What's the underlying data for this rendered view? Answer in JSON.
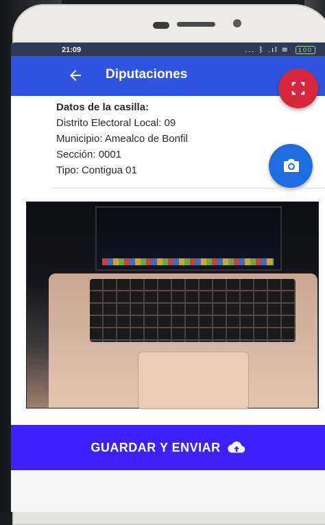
{
  "status_bar": {
    "time": "21:09",
    "indicators": "... ᛒ .ıl ≋",
    "battery": "100"
  },
  "app_bar": {
    "title": "Diputaciones",
    "back_icon": "arrow-left-icon"
  },
  "fab_scan": {
    "icon": "scan-frame-icon",
    "color": "#d7273d"
  },
  "fab_camera": {
    "icon": "camera-icon",
    "color": "#1f6de0"
  },
  "casilla": {
    "heading": "Datos de la casilla:",
    "distrito": "Distrito Electoral Local: 09",
    "municipio": "Municipio: Amealco de Bonfil",
    "seccion": "Sección: 0001",
    "tipo": "Tipo: Contigua 01"
  },
  "photo": {
    "icon": "captured-photo-laptop"
  },
  "save_button": {
    "label": "GUARDAR Y ENVIAR",
    "icon": "cloud-upload-icon",
    "color": "#3d1fff"
  },
  "colors": {
    "app_bar": "#2f55e0",
    "status_bar": "#2f3a5a"
  }
}
